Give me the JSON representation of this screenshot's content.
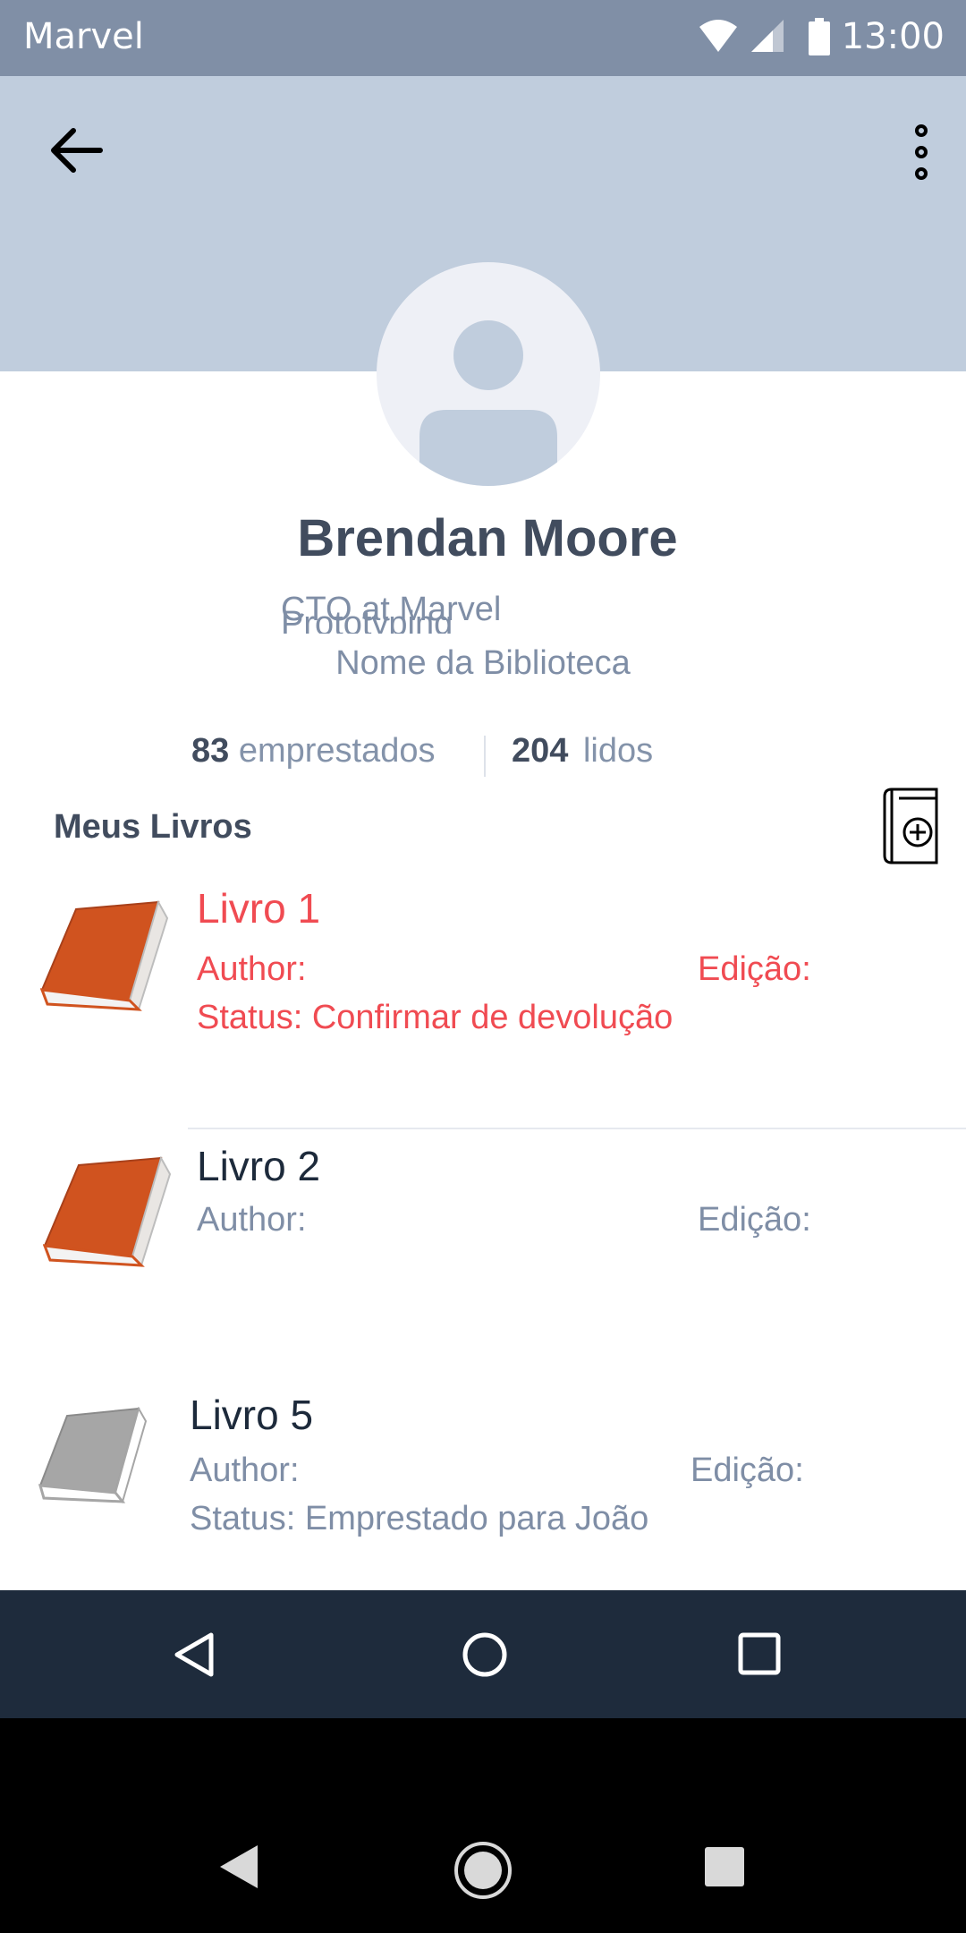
{
  "status_bar": {
    "carrier": "Marvel",
    "time": "13:00"
  },
  "profile": {
    "name": "Brendan Moore",
    "role": "CTO at Marvel",
    "role_ghost": "Prototyping",
    "library": "Nome da Biblioteca",
    "loaned_count": "83",
    "loaned_label": "emprestados",
    "read_count": "204",
    "read_label": "lidos"
  },
  "section": {
    "title": "Meus Livros"
  },
  "books": [
    {
      "title": "Livro 1",
      "author": "Author:",
      "edition": "Edição:",
      "status": "Status: Confirmar de devolução"
    },
    {
      "title": "Livro 2",
      "author": "Author:",
      "edition": "Edição:"
    },
    {
      "title": "Livro 5",
      "author": "Author:",
      "edition": "Edição:",
      "status": "Status: Emprestado para João"
    }
  ],
  "icons": {
    "back": "arrow-left-icon",
    "more": "more-vertical-icon",
    "add_book": "add-book-icon",
    "book_cover": "book-icon",
    "nav_back": "triangle-back-icon",
    "nav_home": "circle-home-icon",
    "nav_recent": "square-recent-icon"
  },
  "colors": {
    "status_bar": "#808fa6",
    "header": "#c0cddd",
    "alert_text": "#f04b52",
    "muted_text": "#7f8ea6",
    "dark_text": "#414c5e",
    "book_active": "#d0531f",
    "book_inactive": "#a6a6a6",
    "nav_bar": "#1e2b3c"
  }
}
